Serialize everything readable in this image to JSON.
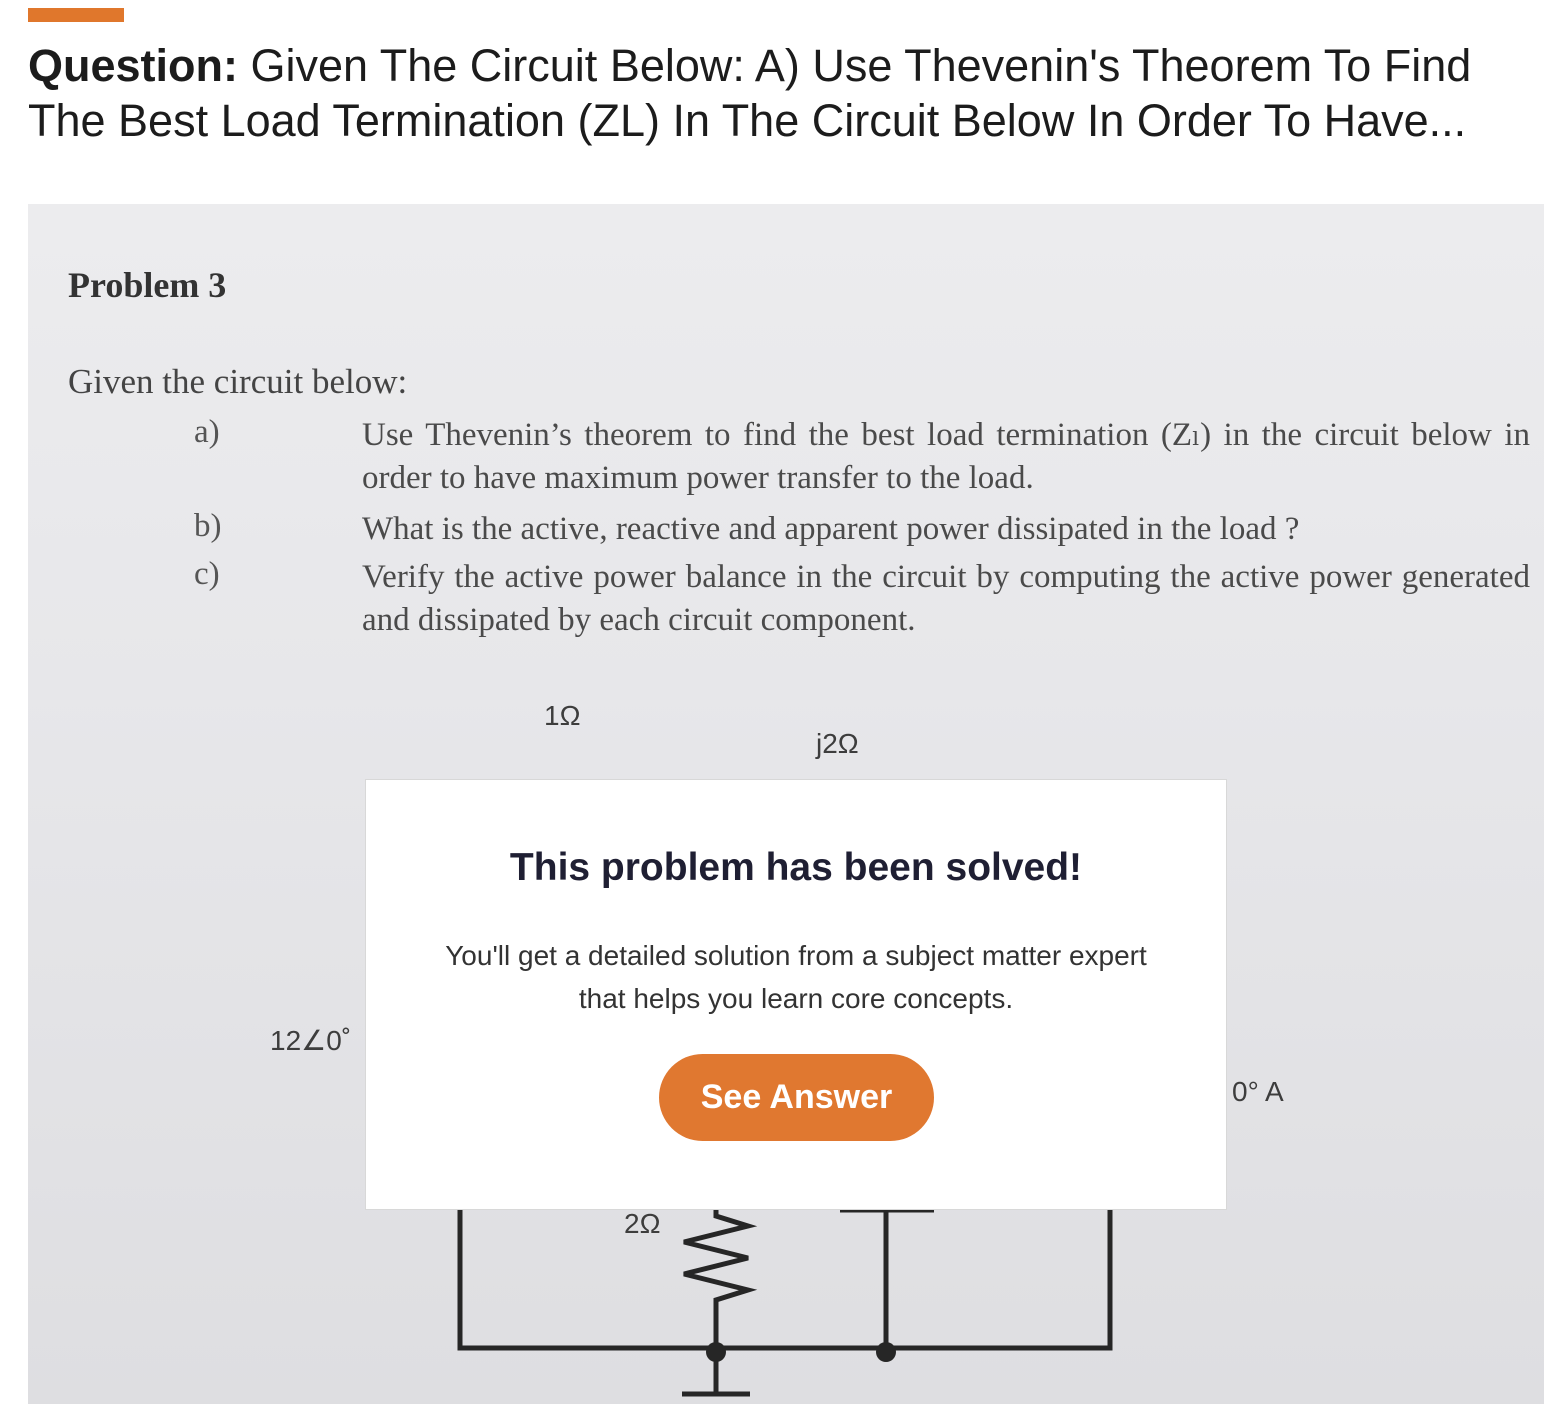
{
  "header": {
    "question_label": "Question:",
    "question_line1": "Given The Circuit Below: A) Use Thevenin's Theorem To Find",
    "question_line2": "The Best Load Termination (ZL) In The Circuit Below In Order To Have..."
  },
  "problem": {
    "heading": "Problem 3",
    "intro": "Given the circuit below:",
    "parts": [
      {
        "letter": "a)",
        "text": "Use Thevenin’s theorem to find the best load termination (Zₗ) in the circuit below in order to have maximum power transfer to the load."
      },
      {
        "letter": "b)",
        "text": "What is the active, reactive and apparent power dissipated in the load ?"
      },
      {
        "letter": "c)",
        "text": "Verify the active power balance in the circuit by computing the active power generated and dissipated by each circuit component."
      }
    ],
    "circuit_labels": {
      "r1": "1Ω",
      "jx": "j2Ω",
      "voltage_source": "12∠0˚",
      "current_source": "0° A",
      "r2": "2Ω"
    }
  },
  "overlay": {
    "heading": "This problem has been solved!",
    "body": "You'll get a detailed solution from a subject matter expert that helps you learn core concepts.",
    "button_label": "See Answer"
  },
  "colors": {
    "accent": "#e0772c",
    "button": "#e07830",
    "heading": "#1f1f33"
  }
}
